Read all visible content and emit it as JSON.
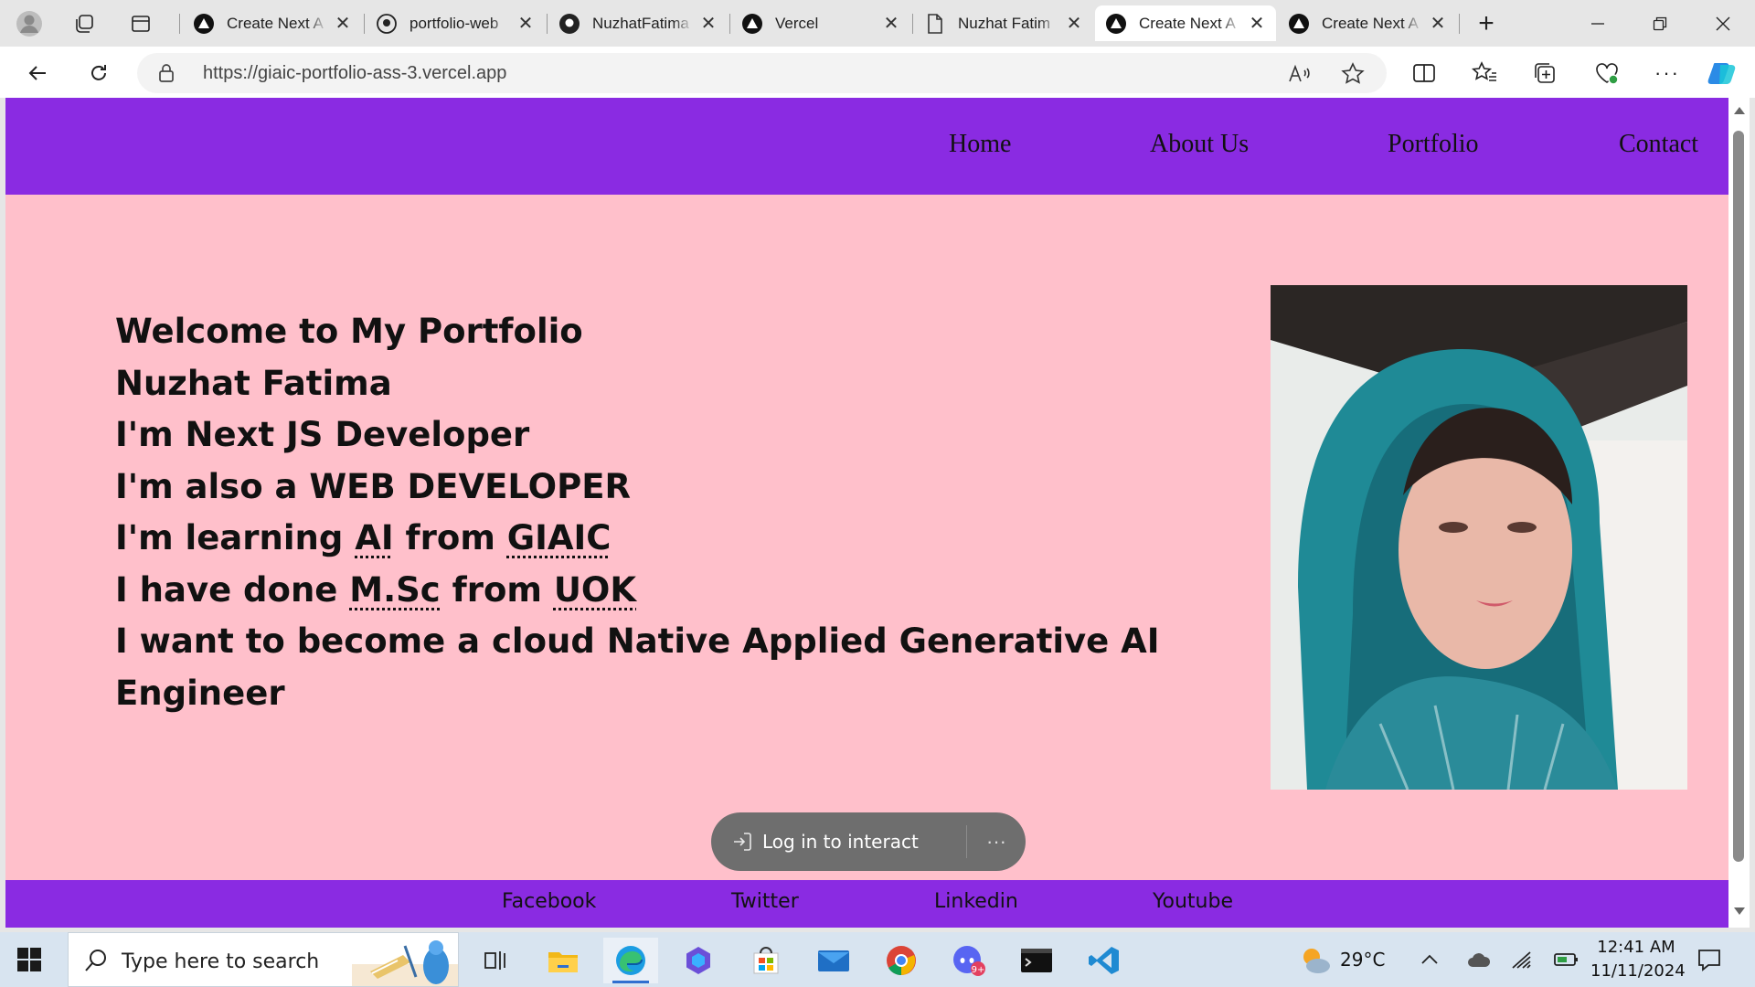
{
  "browser": {
    "tabs": [
      {
        "title": "Create Next A",
        "icon": "vercel-icon",
        "active": false
      },
      {
        "title": "portfolio-web",
        "icon": "github-icon",
        "active": false
      },
      {
        "title": "NuzhatFatima",
        "icon": "github-icon",
        "active": false
      },
      {
        "title": "Vercel",
        "icon": "vercel-icon",
        "active": false
      },
      {
        "title": "Nuzhat Fatim",
        "icon": "document-icon",
        "active": false
      },
      {
        "title": "Create Next A",
        "icon": "vercel-icon",
        "active": true
      },
      {
        "title": "Create Next A",
        "icon": "vercel-icon",
        "active": false
      }
    ],
    "url": "https://giaic-portfolio-ass-3.vercel.app"
  },
  "site": {
    "nav": [
      "Home",
      "About Us",
      "Portfolio",
      "Contact"
    ],
    "hero_lines": [
      "Welcome to My Portfolio",
      "Nuzhat Fatima",
      "I'm Next JS Developer",
      "I'm also a WEB DEVELOPER"
    ],
    "line5": {
      "pre": "I'm learning ",
      "a1": "AI",
      "mid": " from ",
      "a2": "GIAIC"
    },
    "line6": {
      "pre": "I have done ",
      "a1": "M.Sc",
      "mid": " from ",
      "a2": "UOK"
    },
    "line7": "I want to become a cloud Native Applied Generative AI",
    "line8": "Engineer",
    "footer": [
      "Facebook",
      "Twitter",
      "Linkedin",
      "Youtube"
    ],
    "toolbar": {
      "login": "Log in to interact",
      "more": "···"
    },
    "colors": {
      "header": "#8a2be2",
      "background": "#ffc0cb"
    }
  },
  "taskbar": {
    "search_placeholder": "Type here to search",
    "weather": "29°C",
    "time": "12:41 AM",
    "date": "11/11/2024"
  }
}
